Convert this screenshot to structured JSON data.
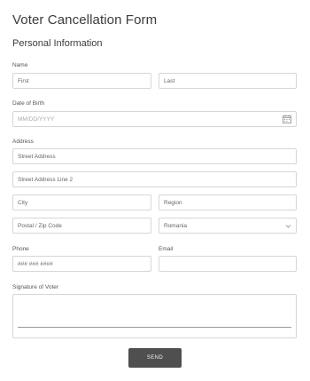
{
  "form": {
    "title": "Voter Cancellation Form",
    "section": "Personal Information",
    "name": {
      "label": "Name",
      "first_placeholder": "First",
      "last_placeholder": "Last"
    },
    "dob": {
      "label": "Date of Birth",
      "placeholder": "MM/DD/YYYY",
      "icon": "calendar-icon"
    },
    "address": {
      "label": "Address",
      "street_placeholder": "Street Address",
      "street2_placeholder": "Street Address Line 2",
      "city_placeholder": "City",
      "region_placeholder": "Region",
      "postal_placeholder": "Postal / Zip Code",
      "country_value": "Romania",
      "country_icon": "chevron-down-icon"
    },
    "phone": {
      "label": "Phone",
      "placeholder": "### ### ####"
    },
    "email": {
      "label": "Email",
      "placeholder": ""
    },
    "signature": {
      "label": "Signature of Voter"
    },
    "submit_label": "SEND"
  }
}
